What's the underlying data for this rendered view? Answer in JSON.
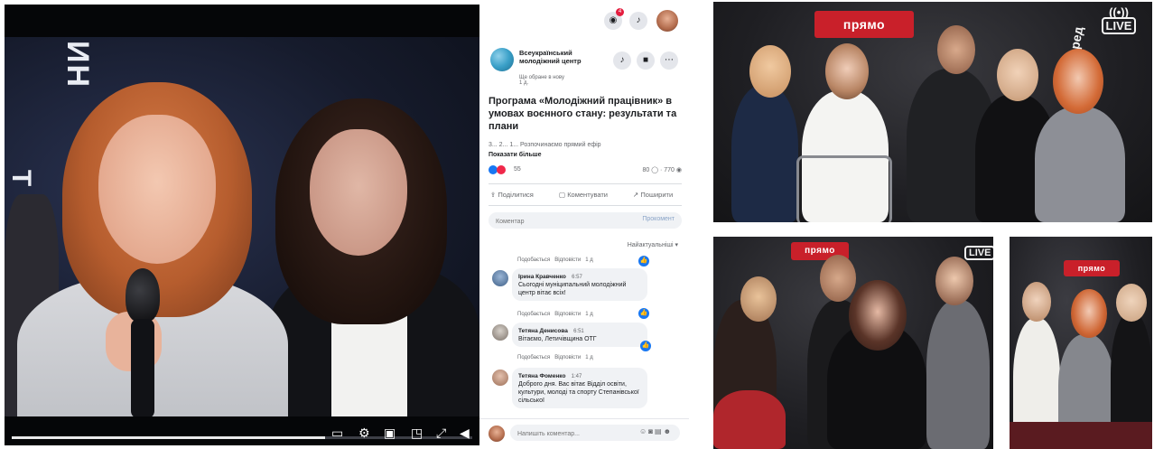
{
  "video": {
    "wall_text_top": "ИН",
    "wall_text_left": "Т",
    "progress_fraction": 0.68
  },
  "facebook": {
    "notifications_count": "4",
    "page": {
      "name": "Всеукраїнський молодіжний центр",
      "sub": "Ще обране в нову",
      "time": "1 д."
    },
    "post": {
      "title": "Програма «Молодіжний працівник» в умовах воєнного стану: результати та плани",
      "snippet": "3... 2... 1... Розпочинаємо прямий ефір",
      "see_more": "Показати більше",
      "reactions_count": "55",
      "stats": "80 ◯ · 770 ◉"
    },
    "actions": {
      "share": "Поділитися",
      "comment": "Коментувати",
      "more_share": "Поширити"
    },
    "comment_box": {
      "placeholder": "Коментар",
      "publish": "Прокомент"
    },
    "sort_label": "Найактуальніші ▾",
    "meta_actions": {
      "reply": "Подобається",
      "answer": "Відповісти",
      "ago": "1 д"
    },
    "comments": [
      {
        "name": "Ірина Кравченко",
        "time": "6:57",
        "text": "Сьогодні муніципальний молодіжний центр вітає всіх!"
      },
      {
        "name": "Тетяна Денисова",
        "time": "6:51",
        "text": "Вітаємо, Летичівщина ОТГ"
      },
      {
        "name": "Тетяна Фоменко",
        "time": "1:47",
        "text": "Доброго дня. Вас вітає Відділ освіти, культури, молоді та спорту Степанівської сільської"
      }
    ],
    "bottom_input": {
      "placeholder": "Напишіть коментар..."
    }
  },
  "photos": {
    "top_badge": "прямо",
    "top_live": "LIVE",
    "top_side": "перед",
    "bottom_left_badge": "прямо",
    "bottom_left_live": "LIVE",
    "bottom_right_badge": "прямо"
  }
}
